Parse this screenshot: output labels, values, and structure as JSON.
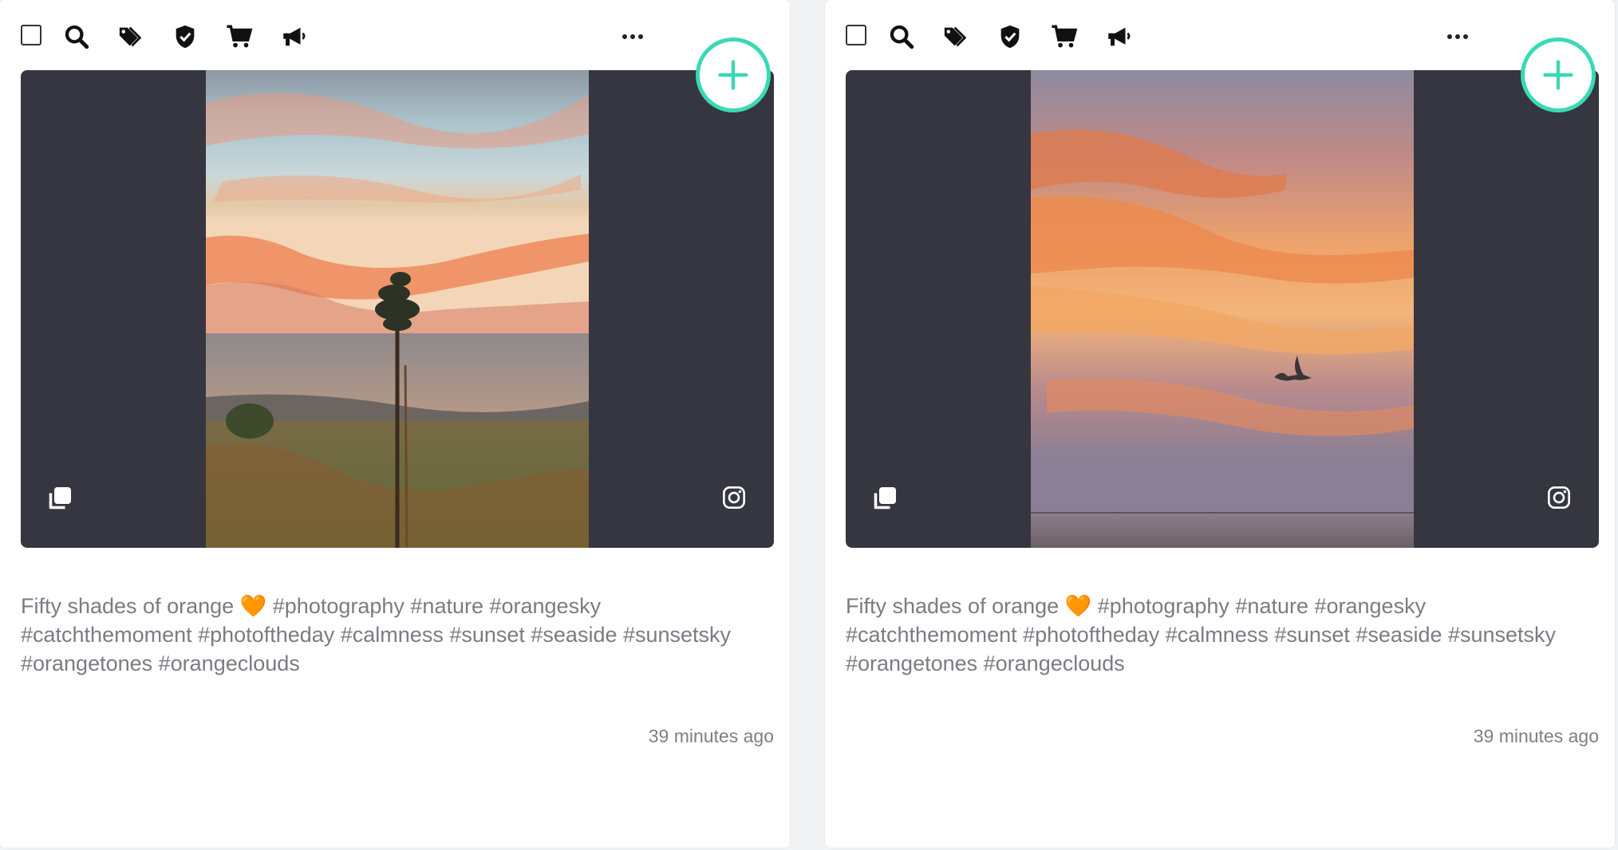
{
  "cards": [
    {
      "caption": "Fifty shades of orange 🧡 #photography #nature #orangesky #catchthemoment  #photoftheday #calmness #sunset #seaside #sunsetsky #orangetones #orangeclouds",
      "timestamp": "39 minutes ago",
      "photo": "sunset-tree-seaside",
      "icons": [
        "checkbox",
        "search-icon",
        "tags-icon",
        "shield-icon",
        "cart-icon",
        "megaphone-icon",
        "more-icon",
        "add-icon",
        "carousel-icon",
        "instagram-icon"
      ]
    },
    {
      "caption": "Fifty shades of orange 🧡 #photography #nature #orangesky #catchthemoment  #photoftheday #calmness #sunset #seaside #sunsetsky #orangetones #orangeclouds",
      "timestamp": "39 minutes ago",
      "photo": "sunset-clouds-seagull",
      "icons": [
        "checkbox",
        "search-icon",
        "tags-icon",
        "shield-icon",
        "cart-icon",
        "megaphone-icon",
        "more-icon",
        "add-icon",
        "carousel-icon",
        "instagram-icon"
      ]
    }
  ],
  "colors": {
    "accent": "#3ad9b5",
    "media_bg": "#363640",
    "caption": "#7a7c84"
  }
}
